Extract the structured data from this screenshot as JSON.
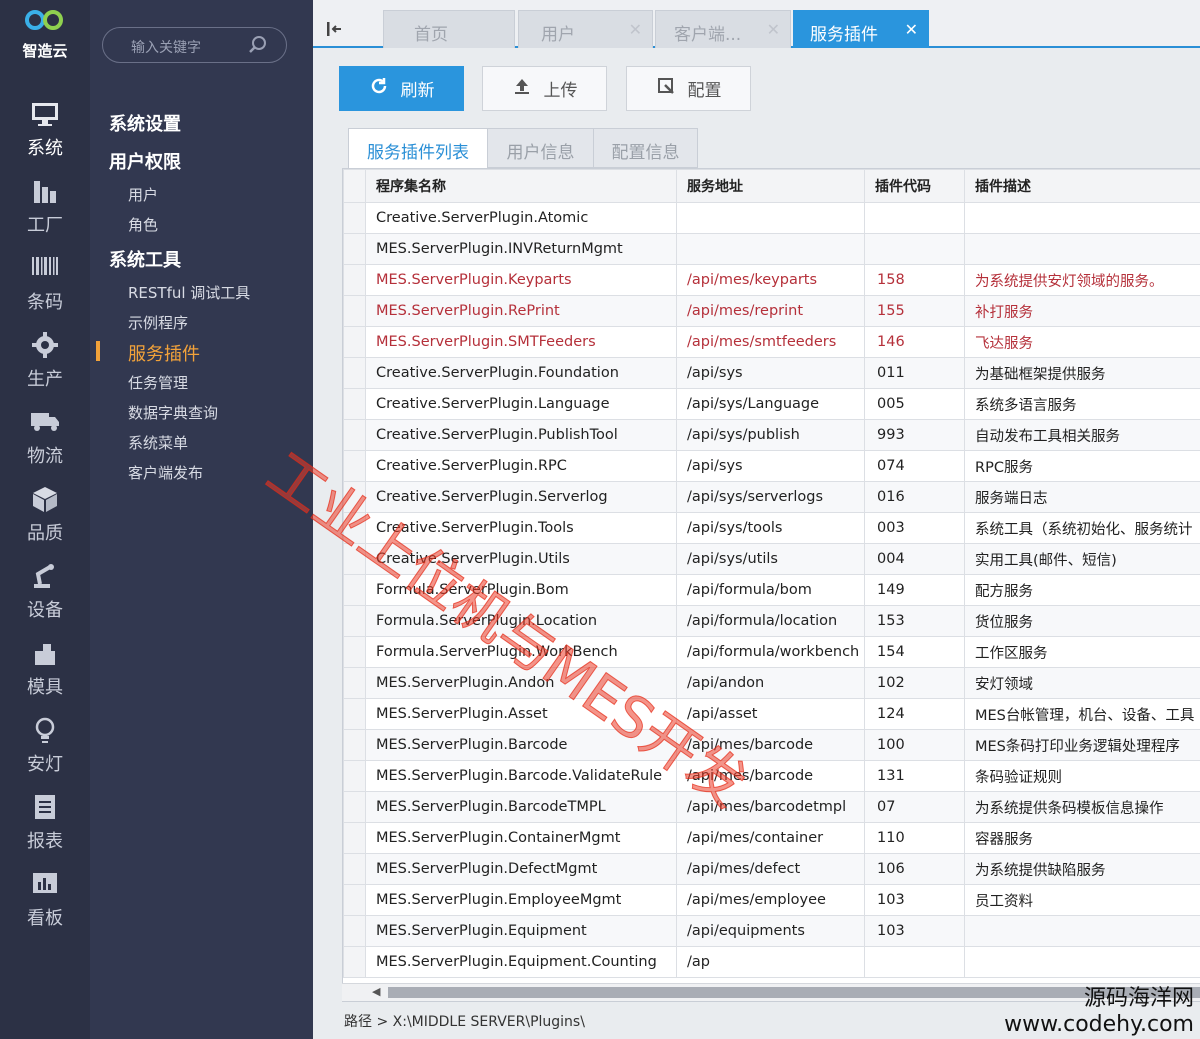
{
  "brand": {
    "name": "智造云"
  },
  "rail": [
    {
      "label": "系统",
      "icon": "monitor-icon"
    },
    {
      "label": "工厂",
      "icon": "factory-icon"
    },
    {
      "label": "条码",
      "icon": "barcode-icon"
    },
    {
      "label": "生产",
      "icon": "gear-icon"
    },
    {
      "label": "物流",
      "icon": "truck-icon"
    },
    {
      "label": "品质",
      "icon": "box-icon"
    },
    {
      "label": "设备",
      "icon": "robot-arm-icon"
    },
    {
      "label": "模具",
      "icon": "mold-icon"
    },
    {
      "label": "安灯",
      "icon": "lightbulb-icon"
    },
    {
      "label": "报表",
      "icon": "report-icon"
    },
    {
      "label": "看板",
      "icon": "dashboard-icon"
    }
  ],
  "search": {
    "placeholder": "输入关键字"
  },
  "menu": {
    "system_settings": "系统设置",
    "user_permissions": "用户权限",
    "users": "用户",
    "roles": "角色",
    "system_tools": "系统工具",
    "tools": [
      "RESTful 调试工具",
      "示例程序",
      "服务插件",
      "任务管理",
      "数据字典查询",
      "系统菜单",
      "客户端发布"
    ]
  },
  "tabs": [
    {
      "label": "首页"
    },
    {
      "label": "用户"
    },
    {
      "label": "客户端..."
    },
    {
      "label": "服务插件"
    }
  ],
  "toolbar": {
    "refresh": "刷新",
    "upload": "上传",
    "config": "配置"
  },
  "subtabs": [
    "服务插件列表",
    "用户信息",
    "配置信息"
  ],
  "columns": [
    "程序集名称",
    "服务地址",
    "插件代码",
    "插件描述"
  ],
  "rows": [
    [
      "Creative.ServerPlugin.Atomic",
      "",
      "",
      ""
    ],
    [
      "MES.ServerPlugin.INVReturnMgmt",
      "",
      "",
      ""
    ],
    [
      "MES.ServerPlugin.Keyparts",
      "/api/mes/keyparts",
      "158",
      "为系统提供安灯领域的服务。"
    ],
    [
      "MES.ServerPlugin.RePrint",
      "/api/mes/reprint",
      "155",
      "补打服务"
    ],
    [
      "MES.ServerPlugin.SMTFeeders",
      "/api/mes/smtfeeders",
      "146",
      "飞达服务"
    ],
    [
      "Creative.ServerPlugin.Foundation",
      "/api/sys",
      "011",
      "为基础框架提供服务"
    ],
    [
      "Creative.ServerPlugin.Language",
      "/api/sys/Language",
      "005",
      "系统多语言服务"
    ],
    [
      "Creative.ServerPlugin.PublishTool",
      "/api/sys/publish",
      "993",
      "自动发布工具相关服务"
    ],
    [
      "Creative.ServerPlugin.RPC",
      "/api/sys",
      "074",
      "RPC服务"
    ],
    [
      "Creative.ServerPlugin.Serverlog",
      "/api/sys/serverlogs",
      "016",
      "服务端日志"
    ],
    [
      "Creative.ServerPlugin.Tools",
      "/api/sys/tools",
      "003",
      "系统工具（系统初始化、服务统计"
    ],
    [
      "Creative.ServerPlugin.Utils",
      "/api/sys/utils",
      "004",
      "实用工具(邮件、短信)"
    ],
    [
      "Formula.ServerPlugin.Bom",
      "/api/formula/bom",
      "149",
      "配方服务"
    ],
    [
      "Formula.ServerPlugin.Location",
      "/api/formula/location",
      "153",
      "货位服务"
    ],
    [
      "Formula.ServerPlugin.WorkBench",
      "/api/formula/workbench",
      "154",
      "工作区服务"
    ],
    [
      "MES.ServerPlugin.Andon",
      "/api/andon",
      "102",
      "安灯领域"
    ],
    [
      "MES.ServerPlugin.Asset",
      "/api/asset",
      "124",
      "MES台帐管理，机台、设备、工具"
    ],
    [
      "MES.ServerPlugin.Barcode",
      "/api/mes/barcode",
      "100",
      "MES条码打印业务逻辑处理程序"
    ],
    [
      "MES.ServerPlugin.Barcode.ValidateRule",
      "/api/mes/barcode",
      "131",
      "条码验证规则"
    ],
    [
      "MES.ServerPlugin.BarcodeTMPL",
      "/api/mes/barcodetmpl",
      "07",
      "为系统提供条码模板信息操作"
    ],
    [
      "MES.ServerPlugin.ContainerMgmt",
      "/api/mes/container",
      "110",
      "容器服务"
    ],
    [
      "MES.ServerPlugin.DefectMgmt",
      "/api/mes/defect",
      "106",
      "为系统提供缺陷服务"
    ],
    [
      "MES.ServerPlugin.EmployeeMgmt",
      "/api/mes/employee",
      "103",
      "员工资料"
    ],
    [
      "MES.ServerPlugin.Equipment",
      "/api/equipments",
      "103",
      ""
    ],
    [
      "MES.ServerPlugin.Equipment.Counting",
      "/ap",
      "",
      ""
    ]
  ],
  "highlight_rows": [
    2,
    3,
    4
  ],
  "highlight_color": "#b5303a",
  "accent_color": "#2a95dd",
  "menu_active_color": "#f2a23a",
  "path": "路径 > X:\\MIDDLE SERVER\\Plugins\\",
  "watermark": {
    "diagonal": "工业上位机与MES开发",
    "site_name": "源码海洋网",
    "site_url": "www.codehy.com"
  }
}
